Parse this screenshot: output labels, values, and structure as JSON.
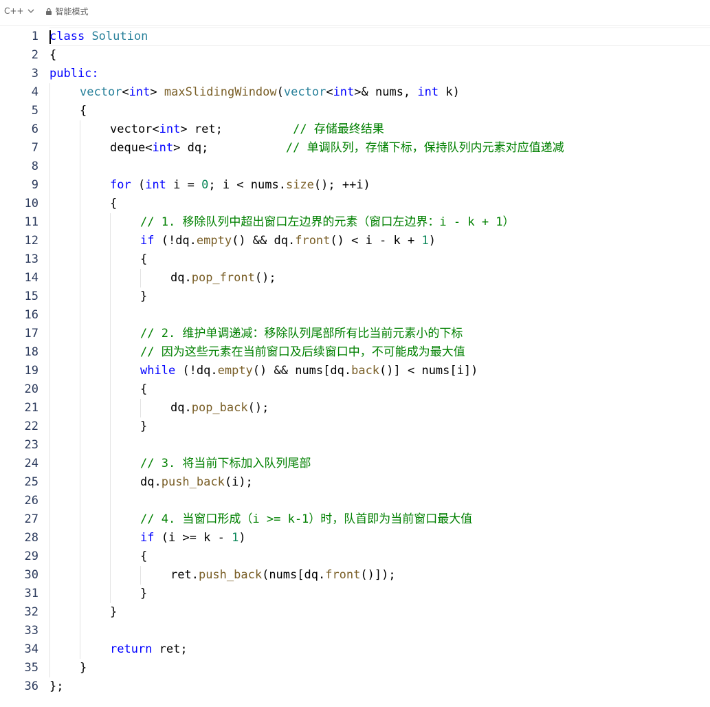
{
  "toolbar": {
    "language": "C++",
    "language_icon": "chevron-down-icon",
    "mode_icon": "lock-icon",
    "mode_label": "智能模式"
  },
  "colors": {
    "keyword": "#0000ff",
    "type": "#267f99",
    "function": "#795e26",
    "number": "#098658",
    "comment": "#008000",
    "default": "#000000",
    "line_number": "#2b3a5c"
  },
  "editor": {
    "lines": [
      {
        "num": "1",
        "indent": 0,
        "tokens": [
          {
            "t": "class",
            "c": "kw"
          },
          {
            "t": " ",
            "c": "df"
          },
          {
            "t": "Solution",
            "c": "ty"
          }
        ]
      },
      {
        "num": "2",
        "indent": 0,
        "tokens": [
          {
            "t": "{",
            "c": "df"
          }
        ]
      },
      {
        "num": "3",
        "indent": 0,
        "tokens": [
          {
            "t": "public:",
            "c": "kw"
          }
        ]
      },
      {
        "num": "4",
        "indent": 1,
        "tokens": [
          {
            "t": "vector",
            "c": "ty"
          },
          {
            "t": "<",
            "c": "df"
          },
          {
            "t": "int",
            "c": "kw"
          },
          {
            "t": "> ",
            "c": "df"
          },
          {
            "t": "maxSlidingWindow",
            "c": "fn"
          },
          {
            "t": "(",
            "c": "df"
          },
          {
            "t": "vector",
            "c": "ty"
          },
          {
            "t": "<",
            "c": "df"
          },
          {
            "t": "int",
            "c": "kw"
          },
          {
            "t": ">& nums, ",
            "c": "df"
          },
          {
            "t": "int",
            "c": "kw"
          },
          {
            "t": " k)",
            "c": "df"
          }
        ]
      },
      {
        "num": "5",
        "indent": 1,
        "tokens": [
          {
            "t": "{",
            "c": "df"
          }
        ]
      },
      {
        "num": "6",
        "indent": 2,
        "tokens": [
          {
            "t": "vector",
            "c": "df"
          },
          {
            "t": "<",
            "c": "df"
          },
          {
            "t": "int",
            "c": "kw"
          },
          {
            "t": "> ret;          ",
            "c": "df"
          },
          {
            "t": "// 存储最终结果",
            "c": "cm"
          }
        ]
      },
      {
        "num": "7",
        "indent": 2,
        "tokens": [
          {
            "t": "deque",
            "c": "df"
          },
          {
            "t": "<",
            "c": "df"
          },
          {
            "t": "int",
            "c": "kw"
          },
          {
            "t": "> dq;           ",
            "c": "df"
          },
          {
            "t": "// 单调队列，存储下标，保持队列内元素对应值递减",
            "c": "cm"
          }
        ]
      },
      {
        "num": "8",
        "indent": 2,
        "tokens": []
      },
      {
        "num": "9",
        "indent": 2,
        "tokens": [
          {
            "t": "for",
            "c": "kw"
          },
          {
            "t": " (",
            "c": "df"
          },
          {
            "t": "int",
            "c": "kw"
          },
          {
            "t": " i = ",
            "c": "df"
          },
          {
            "t": "0",
            "c": "nm"
          },
          {
            "t": "; i < nums.",
            "c": "df"
          },
          {
            "t": "size",
            "c": "fn"
          },
          {
            "t": "(); ++i)",
            "c": "df"
          }
        ]
      },
      {
        "num": "10",
        "indent": 2,
        "tokens": [
          {
            "t": "{",
            "c": "df"
          }
        ]
      },
      {
        "num": "11",
        "indent": 3,
        "tokens": [
          {
            "t": "// 1. 移除队列中超出窗口左边界的元素（窗口左边界：i - k + 1）",
            "c": "cm"
          }
        ]
      },
      {
        "num": "12",
        "indent": 3,
        "tokens": [
          {
            "t": "if",
            "c": "kw"
          },
          {
            "t": " (!dq.",
            "c": "df"
          },
          {
            "t": "empty",
            "c": "fn"
          },
          {
            "t": "() && dq.",
            "c": "df"
          },
          {
            "t": "front",
            "c": "fn"
          },
          {
            "t": "() < i - k + ",
            "c": "df"
          },
          {
            "t": "1",
            "c": "nm"
          },
          {
            "t": ")",
            "c": "df"
          }
        ]
      },
      {
        "num": "13",
        "indent": 3,
        "tokens": [
          {
            "t": "{",
            "c": "df"
          }
        ]
      },
      {
        "num": "14",
        "indent": 4,
        "tokens": [
          {
            "t": "dq.",
            "c": "df"
          },
          {
            "t": "pop_front",
            "c": "fn"
          },
          {
            "t": "();",
            "c": "df"
          }
        ]
      },
      {
        "num": "15",
        "indent": 3,
        "tokens": [
          {
            "t": "}",
            "c": "df"
          }
        ]
      },
      {
        "num": "16",
        "indent": 3,
        "tokens": []
      },
      {
        "num": "17",
        "indent": 3,
        "tokens": [
          {
            "t": "// 2. 维护单调递减：移除队列尾部所有比当前元素小的下标",
            "c": "cm"
          }
        ]
      },
      {
        "num": "18",
        "indent": 3,
        "tokens": [
          {
            "t": "// 因为这些元素在当前窗口及后续窗口中，不可能成为最大值",
            "c": "cm"
          }
        ]
      },
      {
        "num": "19",
        "indent": 3,
        "tokens": [
          {
            "t": "while",
            "c": "kw"
          },
          {
            "t": " (!dq.",
            "c": "df"
          },
          {
            "t": "empty",
            "c": "fn"
          },
          {
            "t": "() && nums[dq.",
            "c": "df"
          },
          {
            "t": "back",
            "c": "fn"
          },
          {
            "t": "()] < nums[i])",
            "c": "df"
          }
        ]
      },
      {
        "num": "20",
        "indent": 3,
        "tokens": [
          {
            "t": "{",
            "c": "df"
          }
        ]
      },
      {
        "num": "21",
        "indent": 4,
        "tokens": [
          {
            "t": "dq.",
            "c": "df"
          },
          {
            "t": "pop_back",
            "c": "fn"
          },
          {
            "t": "();",
            "c": "df"
          }
        ]
      },
      {
        "num": "22",
        "indent": 3,
        "tokens": [
          {
            "t": "}",
            "c": "df"
          }
        ]
      },
      {
        "num": "23",
        "indent": 3,
        "tokens": []
      },
      {
        "num": "24",
        "indent": 3,
        "tokens": [
          {
            "t": "// 3. 将当前下标加入队列尾部",
            "c": "cm"
          }
        ]
      },
      {
        "num": "25",
        "indent": 3,
        "tokens": [
          {
            "t": "dq.",
            "c": "df"
          },
          {
            "t": "push_back",
            "c": "fn"
          },
          {
            "t": "(i);",
            "c": "df"
          }
        ]
      },
      {
        "num": "26",
        "indent": 3,
        "tokens": []
      },
      {
        "num": "27",
        "indent": 3,
        "tokens": [
          {
            "t": "// 4. 当窗口形成（i >= k-1）时，队首即为当前窗口最大值",
            "c": "cm"
          }
        ]
      },
      {
        "num": "28",
        "indent": 3,
        "tokens": [
          {
            "t": "if",
            "c": "kw"
          },
          {
            "t": " (i >= k - ",
            "c": "df"
          },
          {
            "t": "1",
            "c": "nm"
          },
          {
            "t": ")",
            "c": "df"
          }
        ]
      },
      {
        "num": "29",
        "indent": 3,
        "tokens": [
          {
            "t": "{",
            "c": "df"
          }
        ]
      },
      {
        "num": "30",
        "indent": 4,
        "tokens": [
          {
            "t": "ret.",
            "c": "df"
          },
          {
            "t": "push_back",
            "c": "fn"
          },
          {
            "t": "(nums[dq.",
            "c": "df"
          },
          {
            "t": "front",
            "c": "fn"
          },
          {
            "t": "()]);",
            "c": "df"
          }
        ]
      },
      {
        "num": "31",
        "indent": 3,
        "tokens": [
          {
            "t": "}",
            "c": "df"
          }
        ]
      },
      {
        "num": "32",
        "indent": 2,
        "tokens": [
          {
            "t": "}",
            "c": "df"
          }
        ]
      },
      {
        "num": "33",
        "indent": 2,
        "tokens": []
      },
      {
        "num": "34",
        "indent": 2,
        "tokens": [
          {
            "t": "return",
            "c": "kw"
          },
          {
            "t": " ret;",
            "c": "df"
          }
        ]
      },
      {
        "num": "35",
        "indent": 1,
        "tokens": [
          {
            "t": "}",
            "c": "df"
          }
        ]
      },
      {
        "num": "36",
        "indent": 0,
        "tokens": [
          {
            "t": "};",
            "c": "df"
          }
        ]
      }
    ]
  }
}
